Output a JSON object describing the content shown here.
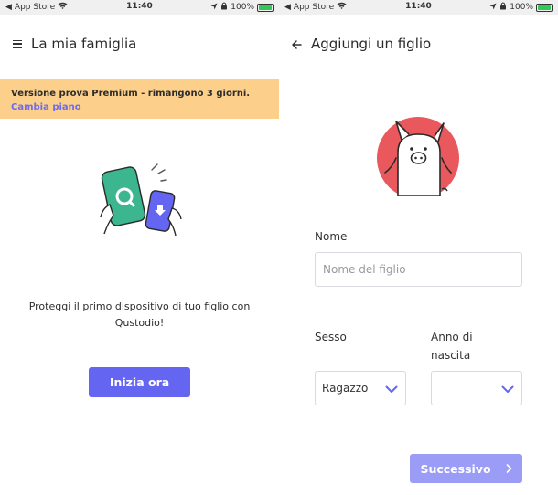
{
  "status_bar": {
    "carrier": "App Store",
    "time": "11:40",
    "battery": "100%"
  },
  "left": {
    "header_title": "La mia famiglia",
    "banner": {
      "text": "Versione prova Premium - rimangono 3 giorni.",
      "link": "Cambia piano"
    },
    "description": "Proteggi il primo dispositivo di tuo figlio con Qustodio!",
    "start_button": "Inizia ora"
  },
  "right": {
    "header_title": "Aggiungi un figlio",
    "name_label": "Nome",
    "name_placeholder": "Nome del figlio",
    "gender_label": "Sesso",
    "gender_value": "Ragazzo",
    "birth_year_label": "Anno di nascita",
    "birth_year_value": "",
    "next_button": "Successivo"
  },
  "colors": {
    "accent": "#6466f1",
    "accent_disabled": "#9b9cf6",
    "banner_bg": "#fcd08a",
    "avatar_bg": "#e8585d",
    "phone_green": "#3bb68f"
  }
}
